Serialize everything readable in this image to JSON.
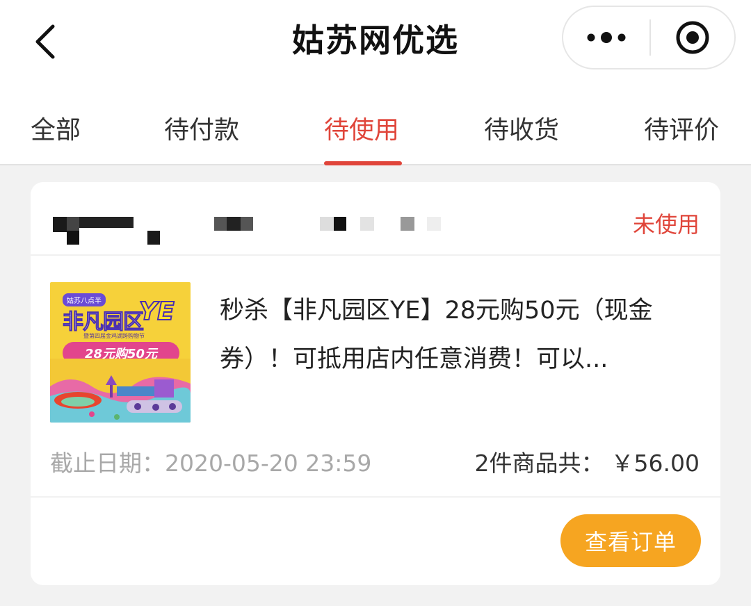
{
  "header": {
    "title": "姑苏网优选"
  },
  "tabs": [
    {
      "label": "全部",
      "active": false
    },
    {
      "label": "待付款",
      "active": false
    },
    {
      "label": "待使用",
      "active": true
    },
    {
      "label": "待收货",
      "active": false
    },
    {
      "label": "待评价",
      "active": false
    }
  ],
  "order": {
    "status": "未使用",
    "product_title": "秒杀【非凡园区YE】28元购50元（现金券）！可抵用店内任意消费！可以...",
    "thumbnail": {
      "tag": "姑苏八点半",
      "title": "非凡园区",
      "badge": "YE",
      "subtitle": "暨第四届金鸡湖跨购物节",
      "banner": "28元购50元"
    },
    "deadline_label": "截止日期：",
    "deadline_value": "2020-05-20 23:59",
    "total_label": "2件商品共：",
    "total_value": "￥56.00",
    "view_button": "查看订单"
  },
  "colors": {
    "accent": "#e0453a",
    "button": "#f6a521",
    "muted": "#a8a8a8"
  },
  "icons": [
    "back-chevron-icon",
    "more-dots-icon",
    "target-icon"
  ]
}
